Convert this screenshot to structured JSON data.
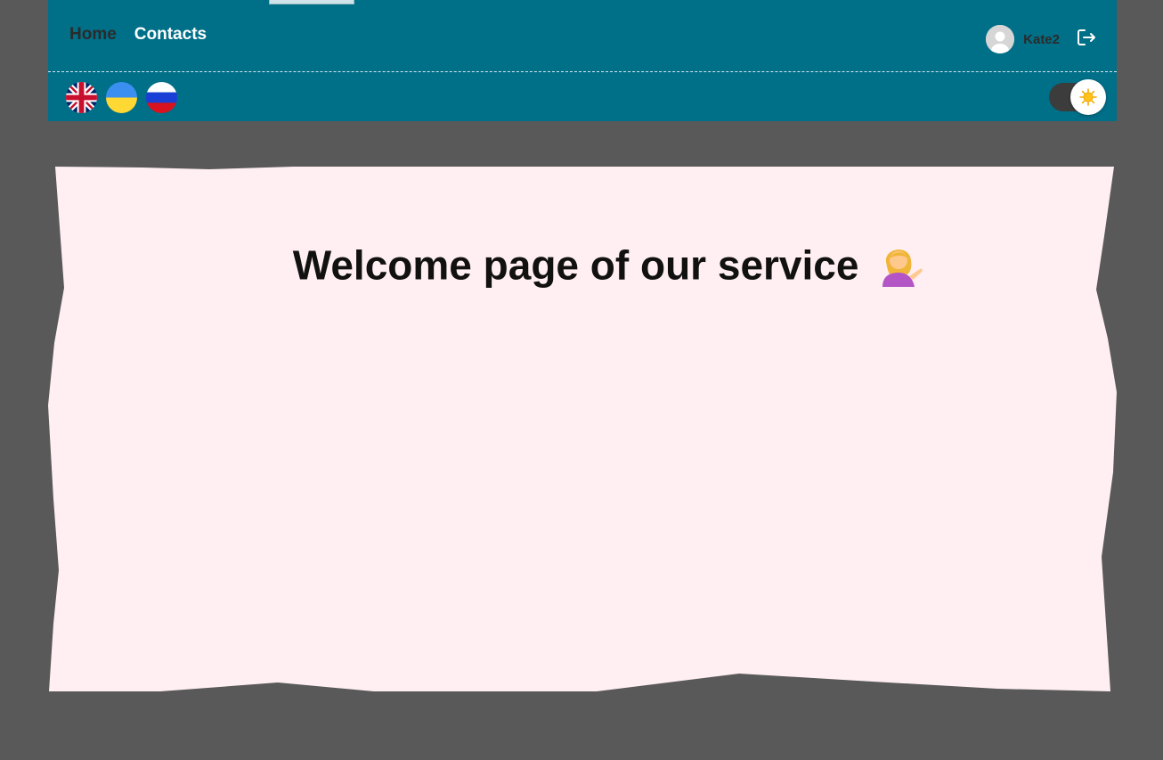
{
  "nav": {
    "home_label": "Home",
    "contacts_label": "Contacts"
  },
  "user": {
    "name": "Kate2"
  },
  "languages": [
    {
      "code": "en",
      "icon": "uk-flag-icon"
    },
    {
      "code": "uk",
      "icon": "ukraine-flag-icon"
    },
    {
      "code": "ru",
      "icon": "russia-flag-icon"
    }
  ],
  "theme_toggle": {
    "icon": "sun-icon"
  },
  "main": {
    "welcome_title": "Welcome page of our service",
    "emoji_icon": "woman-tipping-hand-icon"
  },
  "colors": {
    "header_bg": "#006f88",
    "page_bg": "#595959",
    "card_bg": "#ffeff2",
    "nav_inactive": "#2b2b2b",
    "nav_active": "#ffffff"
  }
}
